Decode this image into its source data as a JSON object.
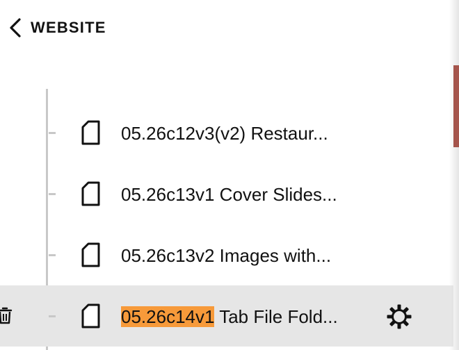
{
  "header": {
    "back_label": "WEBSITE"
  },
  "pages": [
    {
      "label": "05.26c12v3(v2) Restaur..."
    },
    {
      "label": "05.26c13v1 Cover Slides..."
    },
    {
      "label": "05.26c13v2 Images with..."
    },
    {
      "label_highlight": "05.26c14v1",
      "label_rest": " Tab File Fold..."
    }
  ],
  "colors": {
    "highlight": "#f79a3a",
    "selected_row": "#e6e6e6",
    "accent_bar": "#a5554c"
  },
  "icons": {
    "back": "chevron-left-icon",
    "page": "page-icon",
    "delete": "trash-icon",
    "settings": "gear-icon"
  }
}
